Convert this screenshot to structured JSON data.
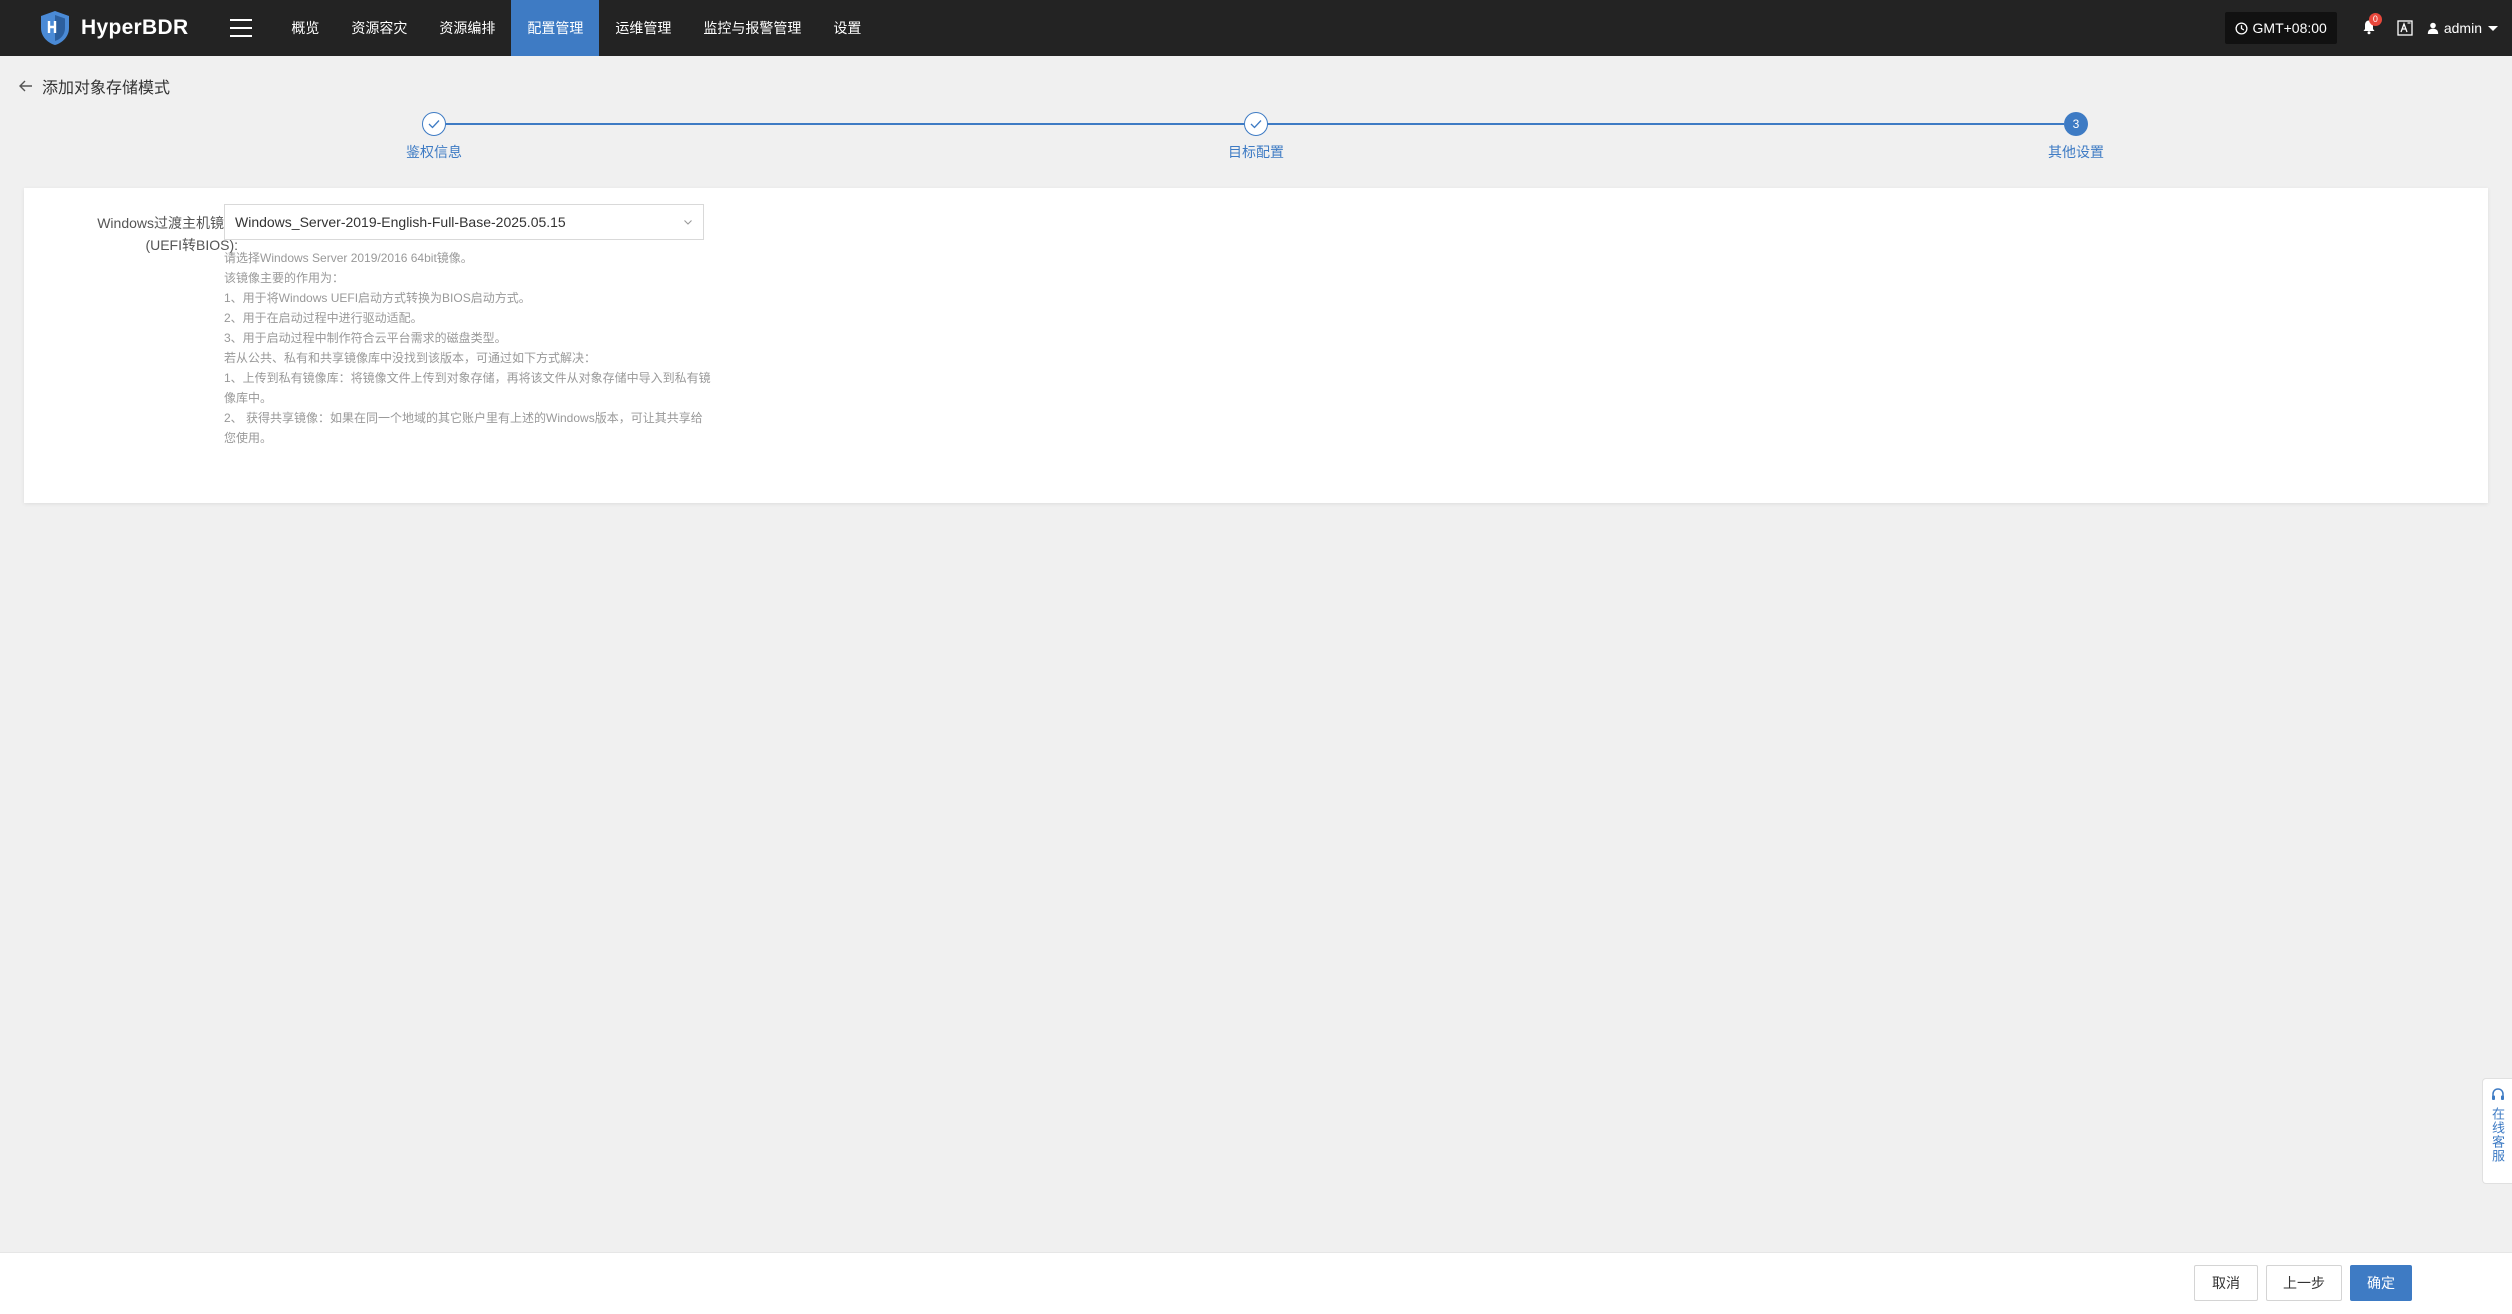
{
  "app": {
    "name": "HyperBDR"
  },
  "nav": [
    {
      "label": "概览",
      "active": false
    },
    {
      "label": "资源容灾",
      "active": false
    },
    {
      "label": "资源编排",
      "active": false
    },
    {
      "label": "配置管理",
      "active": true
    },
    {
      "label": "运维管理",
      "active": false
    },
    {
      "label": "监控与报警管理",
      "active": false
    },
    {
      "label": "设置",
      "active": false
    }
  ],
  "header": {
    "timezone": "GMT+08:00",
    "notification_count": "0",
    "user": "admin"
  },
  "page": {
    "title": "添加对象存储模式"
  },
  "steps": [
    {
      "label": "鉴权信息",
      "status": "done"
    },
    {
      "label": "目标配置",
      "status": "done"
    },
    {
      "label": "其他设置",
      "status": "current",
      "number": "3"
    }
  ],
  "form": {
    "label_line1": "Windows过渡主机镜像",
    "label_line2": "(UEFI转BIOS):",
    "selected_image": "Windows_Server-2019-English-Full-Base-2025.05.15",
    "help": [
      "请选择Windows Server 2019/2016 64bit镜像。",
      "该镜像主要的作用为：",
      "1、用于将Windows UEFI启动方式转换为BIOS启动方式。",
      "2、用于在启动过程中进行驱动适配。",
      "3、用于启动过程中制作符合云平台需求的磁盘类型。",
      "若从公共、私有和共享镜像库中没找到该版本，可通过如下方式解决：",
      "1、上传到私有镜像库：将镜像文件上传到对象存储，再将该文件从对象存储中导入到私有镜像库中。",
      "2、 获得共享镜像：如果在同一个地域的其它账户里有上述的Windows版本，可让其共享给您使用。"
    ]
  },
  "footer": {
    "cancel": "取消",
    "prev": "上一步",
    "confirm": "确定"
  },
  "service_widget": {
    "label": "在线客服"
  },
  "colors": {
    "accent": "#3e7bc4",
    "topbar": "#232323",
    "badge": "#e8473b"
  }
}
